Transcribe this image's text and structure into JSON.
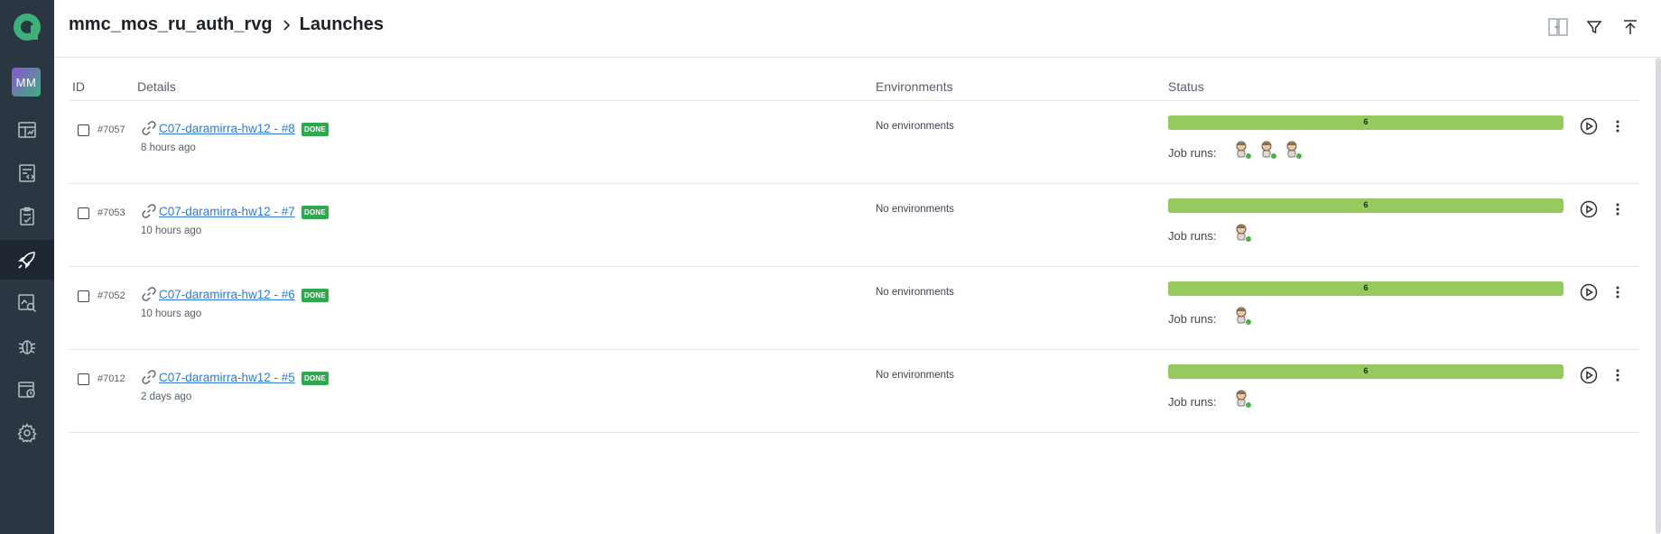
{
  "sidebar": {
    "avatar_initials": "MM",
    "items": [
      {
        "name": "dashboard",
        "icon": "dashboard-icon",
        "active": false
      },
      {
        "name": "test-cases",
        "icon": "code-file-icon",
        "active": false
      },
      {
        "name": "test-plans",
        "icon": "clipboard-check-icon",
        "active": false
      },
      {
        "name": "launches",
        "icon": "rocket-icon",
        "active": true
      },
      {
        "name": "analytics",
        "icon": "chart-search-icon",
        "active": false
      },
      {
        "name": "defects",
        "icon": "bug-icon",
        "active": false
      },
      {
        "name": "jobs",
        "icon": "schedule-icon",
        "active": false
      },
      {
        "name": "settings",
        "icon": "gear-icon",
        "active": false
      }
    ]
  },
  "header": {
    "project": "mmc_mos_ru_auth_rvg",
    "title": "Launches",
    "actions": [
      "compare-icon",
      "filter-icon",
      "upload-icon"
    ]
  },
  "table": {
    "columns": {
      "id": "ID",
      "details": "Details",
      "environments": "Environments",
      "status": "Status"
    },
    "rows": [
      {
        "id": "#7057",
        "name": "C07-daramirra-hw12 - #8",
        "badge": "DONE",
        "time": "8 hours ago",
        "env": "No environments",
        "count": "6",
        "progress": 1.0,
        "job_runs_label": "Job runs:",
        "job_runs": 3
      },
      {
        "id": "#7053",
        "name": "C07-daramirra-hw12 - #7",
        "badge": "DONE",
        "time": "10 hours ago",
        "env": "No environments",
        "count": "6",
        "progress": 1.0,
        "job_runs_label": "Job runs:",
        "job_runs": 1
      },
      {
        "id": "#7052",
        "name": "C07-daramirra-hw12 - #6",
        "badge": "DONE",
        "time": "10 hours ago",
        "env": "No environments",
        "count": "6",
        "progress": 1.0,
        "job_runs_label": "Job runs:",
        "job_runs": 1
      },
      {
        "id": "#7012",
        "name": "C07-daramirra-hw12 - #5",
        "badge": "DONE",
        "time": "2 days ago",
        "env": "No environments",
        "count": "6",
        "progress": 1.0,
        "job_runs_label": "Job runs:",
        "job_runs": 1
      }
    ]
  },
  "colors": {
    "sidebar_bg": "#2b3643",
    "accent_green": "#3fb07a",
    "progress_green": "#96c95e",
    "badge_green": "#2fa84f",
    "link_blue": "#2f7bd5"
  }
}
